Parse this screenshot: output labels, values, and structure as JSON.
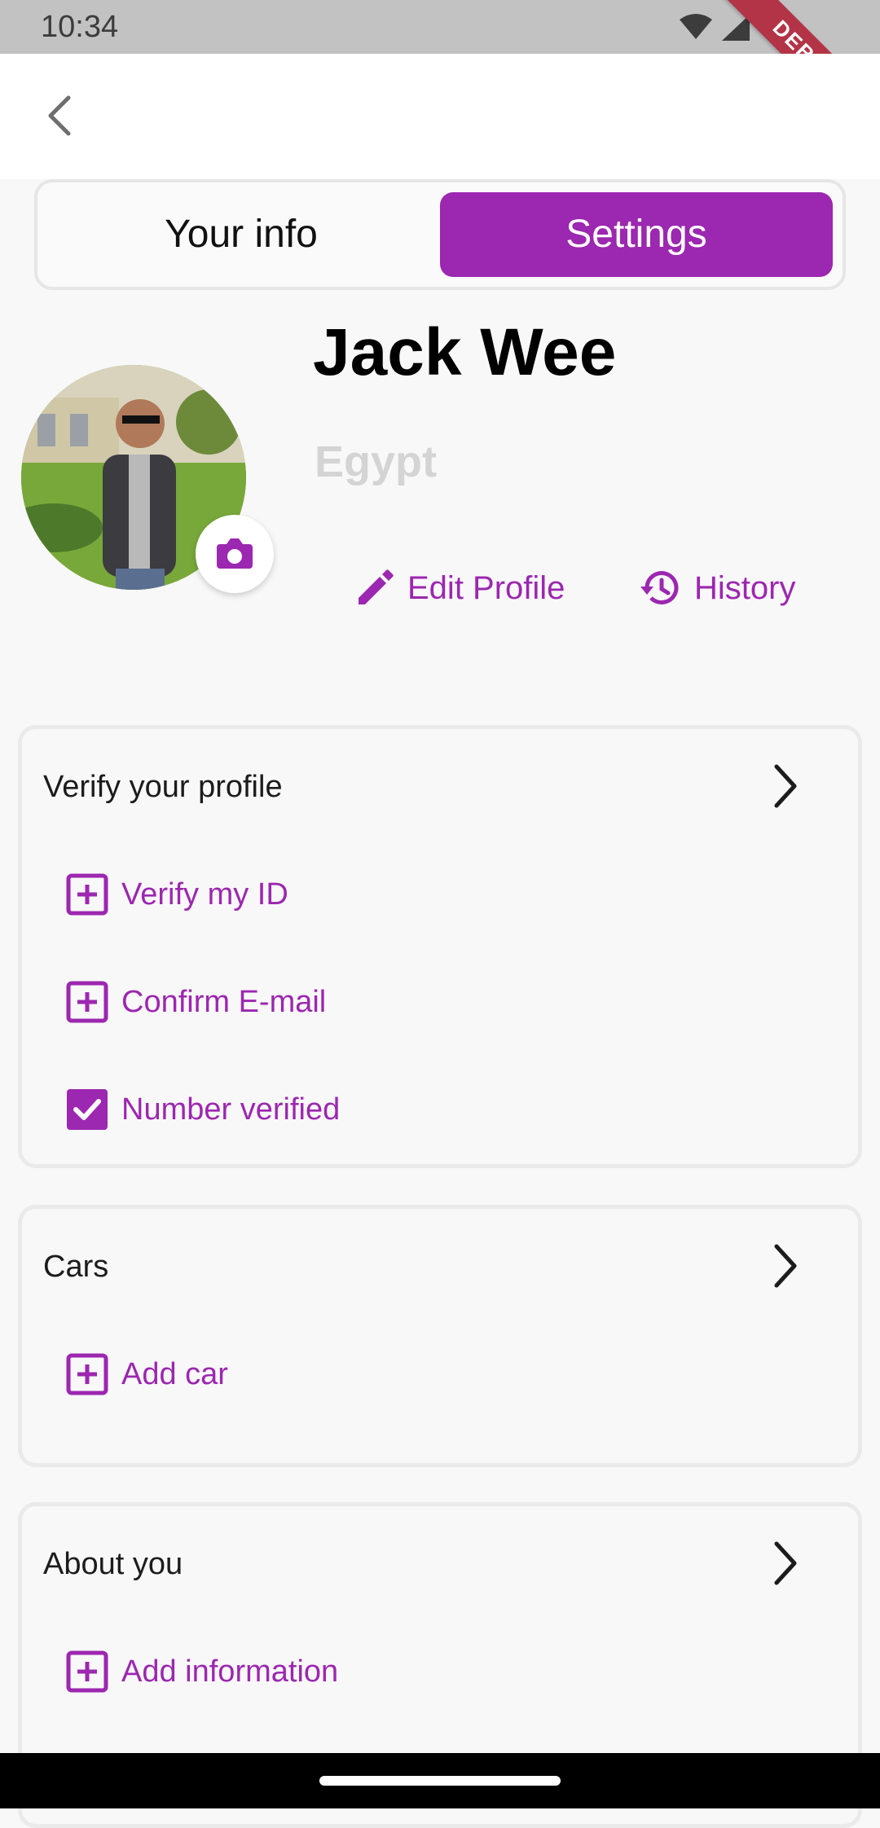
{
  "status_bar": {
    "time": "10:34",
    "debug_label": "DEBUG"
  },
  "tabs": [
    {
      "label": "Your info",
      "selected": false
    },
    {
      "label": "Settings",
      "selected": true
    }
  ],
  "profile": {
    "name": "Jack Wee",
    "country": "Egypt",
    "actions": {
      "edit_label": "Edit Profile",
      "history_label": "History"
    }
  },
  "sections": {
    "verify": {
      "title": "Verify your profile",
      "items": [
        {
          "label": "Verify my ID",
          "icon": "add-box-icon"
        },
        {
          "label": "Confirm E-mail",
          "icon": "add-box-icon"
        },
        {
          "label": "Number verified",
          "icon": "checkbox-checked-icon"
        }
      ]
    },
    "cars": {
      "title": "Cars",
      "items": [
        {
          "label": "Add car",
          "icon": "add-box-icon"
        }
      ]
    },
    "about": {
      "title": "About you",
      "items": [
        {
          "label": "Add information",
          "icon": "add-box-icon"
        }
      ]
    }
  },
  "colors": {
    "accent": "#9c27b0",
    "background": "#f8f8f8",
    "muted_text": "#d4d4d4"
  }
}
